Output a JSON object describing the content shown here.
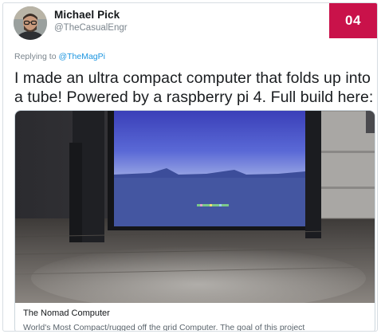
{
  "tweet": {
    "author_name": "Michael Pick",
    "author_handle": "@TheCasualEngr",
    "reply_prefix": "Replying to",
    "reply_mention": "@TheMagPi",
    "text": "I made an ultra compact computer that folds up into a tube! Powered by a raspberry pi 4. Full build here:"
  },
  "badge": {
    "number": "04",
    "color": "#c9124a"
  },
  "link_card": {
    "title": "The Nomad Computer",
    "description": "World's Most Compact/rugged off the grid Computer. The goal of this project"
  },
  "colors": {
    "mention": "#1b95e0",
    "border": "#ccd6dd"
  }
}
